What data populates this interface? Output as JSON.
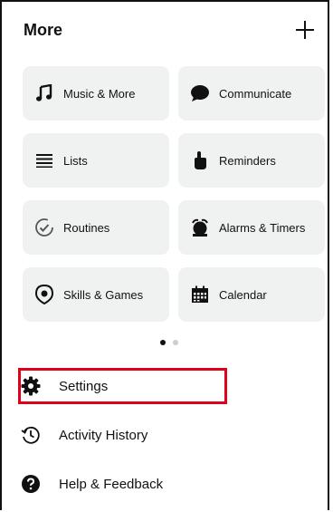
{
  "header": {
    "title": "More",
    "add_icon": "plus-icon"
  },
  "tiles": [
    {
      "label": "Music & More",
      "icon": "music-note-icon"
    },
    {
      "label": "Communicate",
      "icon": "speech-bubble-icon"
    },
    {
      "label": "Lists",
      "icon": "list-icon"
    },
    {
      "label": "Reminders",
      "icon": "hand-pointer-icon"
    },
    {
      "label": "Routines",
      "icon": "routine-check-icon"
    },
    {
      "label": "Alarms & Timers",
      "icon": "alarm-icon"
    },
    {
      "label": "Skills & Games",
      "icon": "location-pin-icon"
    },
    {
      "label": "Calendar",
      "icon": "calendar-icon"
    }
  ],
  "pager": {
    "pages": 2,
    "active": 1
  },
  "menu": {
    "settings": {
      "label": "Settings",
      "icon": "gear-icon"
    },
    "activity_history": {
      "label": "Activity History",
      "icon": "history-icon"
    },
    "help_feedback": {
      "label": "Help & Feedback",
      "icon": "help-icon"
    }
  },
  "colors": {
    "tile_background": "#f0f2f2",
    "highlight_border": "#e0001a",
    "text": "#111111"
  }
}
